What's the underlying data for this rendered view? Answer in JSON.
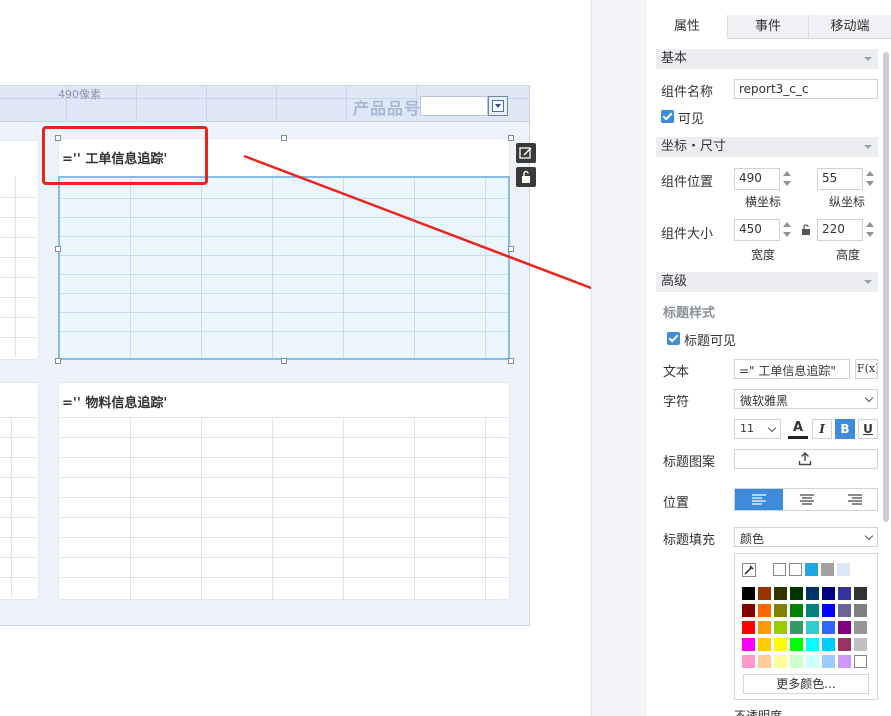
{
  "canvas": {
    "pixel_marker": "490像素",
    "product_label": "产品品号",
    "panel_a": {
      "title": "='' 工单信息追踪'"
    },
    "panel_b": {
      "title": "='' 物料信息追踪'"
    }
  },
  "properties": {
    "tabs": [
      {
        "label": "属性",
        "active": true
      },
      {
        "label": "事件",
        "active": false
      },
      {
        "label": "移动端",
        "active": false
      }
    ],
    "basic": {
      "header": "基本",
      "component_name_label": "组件名称",
      "component_name_value": "report3_c_c",
      "visible_label": "可见",
      "visible_checked": true
    },
    "position": {
      "header": "坐标・尺寸",
      "pos_label": "组件位置",
      "x_value": "490",
      "x_caption": "横坐标",
      "y_value": "55",
      "y_caption": "纵坐标",
      "size_label": "组件大小",
      "width_value": "450",
      "width_caption": "宽度",
      "height_value": "220",
      "height_caption": "高度"
    },
    "advanced": {
      "header": "高级",
      "title_style_label": "标题样式",
      "title_visible_label": "标题可见",
      "title_visible_checked": true,
      "text_label": "文本",
      "text_value": "=\"   工单信息追踪\"",
      "formula_button": "F(x)",
      "font_label": "字符",
      "font_value": "微软雅黑",
      "font_size_value": "11",
      "text_color_button": "A",
      "italic_button": "I",
      "bold_button": "B",
      "underline_button": "U",
      "title_pattern_label": "标题图案",
      "align_label": "位置",
      "fill_label": "标题填充",
      "fill_value": "颜色",
      "more_colors": "更多颜色...",
      "opacity_label": "不透明度"
    }
  },
  "colors": {
    "accent_blue": "#3d8bd9",
    "selection_border": "#88bde8",
    "annotation_red": "#e8251c",
    "palette_recent": [
      "#ffffff",
      "#ffffff",
      "#1ea7e1",
      "#a0a0a0",
      "#dce6f6"
    ],
    "palette_grid": [
      [
        "#000000",
        "#993300",
        "#333300",
        "#003300",
        "#003366",
        "#000080",
        "#333399",
        "#333333"
      ],
      [
        "#800000",
        "#ff6600",
        "#808000",
        "#008000",
        "#008080",
        "#0000ff",
        "#666699",
        "#808080"
      ],
      [
        "#ff0000",
        "#ff9900",
        "#99cc00",
        "#339966",
        "#33cccc",
        "#3366ff",
        "#800080",
        "#969696"
      ],
      [
        "#ff00ff",
        "#ffcc00",
        "#ffff00",
        "#00ff00",
        "#00ffff",
        "#00ccff",
        "#993366",
        "#c0c0c0"
      ],
      [
        "#ff99cc",
        "#ffcc99",
        "#ffff99",
        "#ccffcc",
        "#ccffff",
        "#99ccff",
        "#cc99ff",
        "#ffffff"
      ]
    ]
  }
}
